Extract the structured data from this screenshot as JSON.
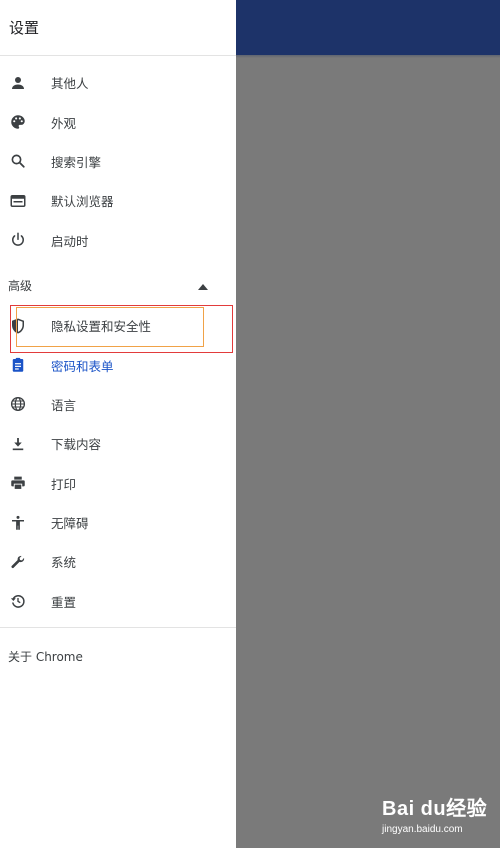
{
  "header": {
    "title": "设置"
  },
  "sidebar": {
    "items": [
      {
        "label": "其他人",
        "icon": "person-icon"
      },
      {
        "label": "外观",
        "icon": "palette-icon"
      },
      {
        "label": "搜索引擎",
        "icon": "search-icon"
      },
      {
        "label": "默认浏览器",
        "icon": "browser-icon"
      },
      {
        "label": "启动时",
        "icon": "power-icon"
      }
    ],
    "advanced": {
      "label": "高级",
      "icon": "triangle-up-icon"
    },
    "advanced_items": [
      {
        "label": "隐私设置和安全性",
        "icon": "shield-icon"
      },
      {
        "label": "密码和表单",
        "icon": "clipboard-icon",
        "active": true
      },
      {
        "label": "语言",
        "icon": "globe-icon"
      },
      {
        "label": "下载内容",
        "icon": "download-icon"
      },
      {
        "label": "打印",
        "icon": "print-icon"
      },
      {
        "label": "无障碍",
        "icon": "accessibility-icon"
      },
      {
        "label": "系统",
        "icon": "wrench-icon"
      },
      {
        "label": "重置",
        "icon": "history-icon"
      }
    ],
    "about": {
      "label": "关于 Chrome"
    }
  },
  "colors": {
    "active": "#1a53c7",
    "top_bar": "#1d3369",
    "scrim": "#7a7a7a",
    "highlight_red": "#e23b3b",
    "highlight_orange": "#f0a248"
  },
  "watermark": {
    "brand": "Bai du经验",
    "url": "jingyan.baidu.com"
  }
}
